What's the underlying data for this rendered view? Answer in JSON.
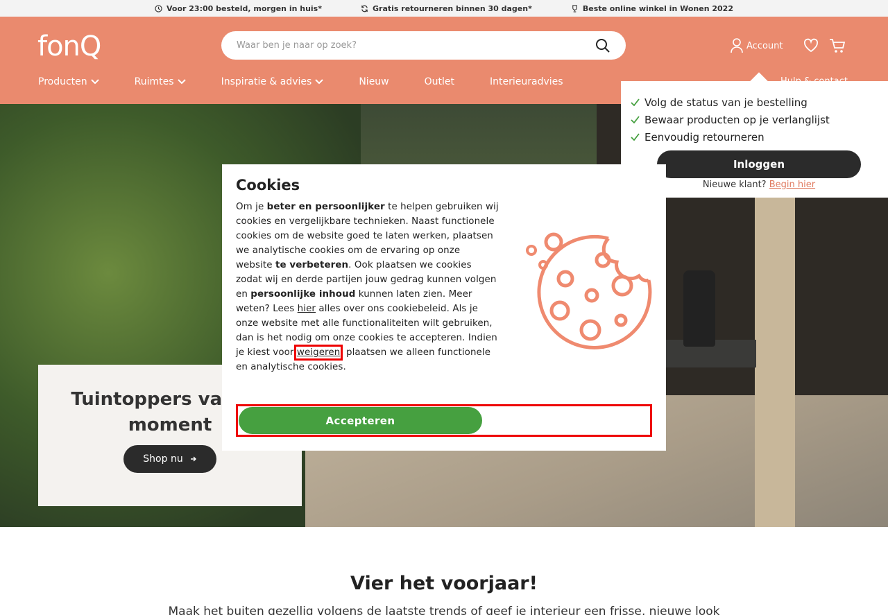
{
  "usp": [
    {
      "icon": "clock-icon",
      "text": "Voor 23:00 besteld, morgen in huis*"
    },
    {
      "icon": "refresh-icon",
      "text": "Gratis retourneren binnen 30 dagen*"
    },
    {
      "icon": "trophy-icon",
      "text": "Beste online winkel in Wonen 2022"
    }
  ],
  "header": {
    "logo": "fonQ",
    "search_placeholder": "Waar ben je naar op zoek?",
    "account_label": "Account",
    "nav": [
      {
        "label": "Producten",
        "dropdown": true
      },
      {
        "label": "Ruimtes",
        "dropdown": true
      },
      {
        "label": "Inspiratie & advies",
        "dropdown": true
      },
      {
        "label": "Nieuw",
        "dropdown": false
      },
      {
        "label": "Outlet",
        "dropdown": false
      },
      {
        "label": "Interieuradvies",
        "dropdown": false
      }
    ],
    "help_label": "Hulp & contact"
  },
  "account_popup": {
    "benefits": [
      "Volg de status van je bestelling",
      "Bewaar producten op je verlanglijst",
      "Eenvoudig retourneren"
    ],
    "login_label": "Inloggen",
    "new_customer_text": "Nieuwe klant?",
    "begin_label": "Begin hier"
  },
  "hero": {
    "title": "Tuintoppers van dit moment",
    "button_label": "Shop nu"
  },
  "cookie_modal": {
    "title": "Cookies",
    "segments": [
      {
        "t": "Om je ",
        "b": false
      },
      {
        "t": "beter en persoonlijker",
        "b": true
      },
      {
        "t": " te helpen gebruiken wij cookies en vergelijkbare technieken. Naast functionele cookies om de website goed te laten werken, plaatsen we analytische cookies om de ervaring op onze website ",
        "b": false
      },
      {
        "t": "te verbeteren",
        "b": true
      },
      {
        "t": ". Ook plaatsen we cookies zodat wij en derde partijen jouw gedrag kunnen volgen en ",
        "b": false
      },
      {
        "t": "persoonlijke inhoud",
        "b": true
      },
      {
        "t": " kunnen laten zien. Meer weten? Lees ",
        "b": false
      }
    ],
    "link_hier": "hier",
    "text_after_hier": " alles over ons cookiebeleid. Als je onze website met alle functionaliteiten wilt gebruiken, dan is het nodig om onze cookies te accepteren. Indien je kiest voor ",
    "link_weigeren": "weigeren",
    "text_end": ", plaatsen we alleen functionele en analytische cookies.",
    "accept_label": "Accepteren",
    "accent": "#46a040",
    "icon": "cookie-icon"
  },
  "section": {
    "title": "Vier het voorjaar!",
    "text": "Maak het buiten gezellig volgens de laatste trends of geef je interieur een frisse, nieuwe look"
  },
  "colors": {
    "brand": "#ea8a6e",
    "dark": "#2b2b2b",
    "highlight": "#e00000"
  }
}
